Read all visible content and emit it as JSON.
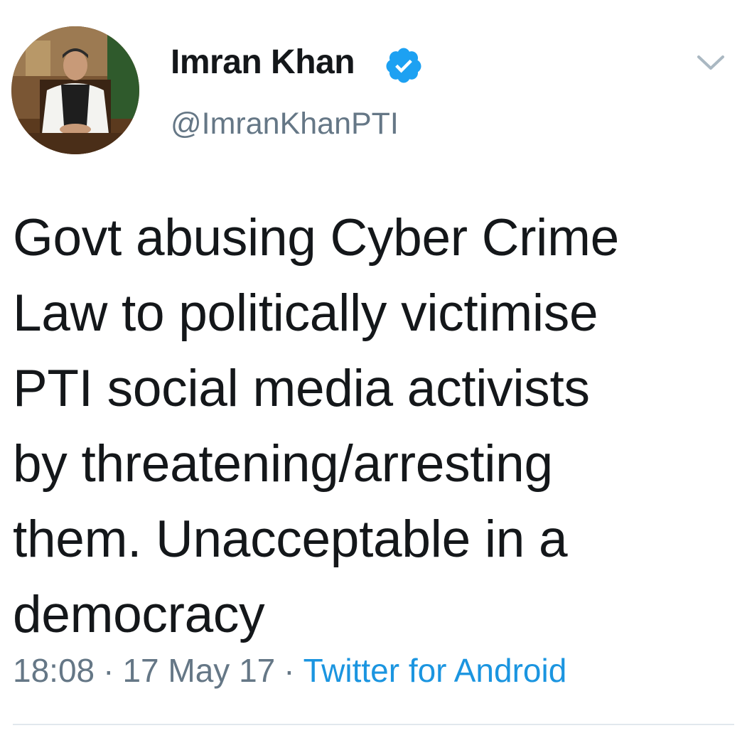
{
  "tweet": {
    "display_name": "Imran Khan",
    "verified": true,
    "handle": "@ImranKhanPTI",
    "text": "Govt abusing Cyber Crime\nLaw to politically victimise\nPTI social media activists\nby threatening/arresting\nthem. Unacceptable in a\ndemocracy",
    "time": "18:08",
    "date": "17 May 17",
    "separator": "·",
    "source": "Twitter for Android"
  },
  "icons": {
    "verified": "verified-badge-icon",
    "menu": "chevron-down-icon"
  },
  "colors": {
    "text": "#14171a",
    "secondary": "#657786",
    "link": "#1b95e0",
    "verified": "#1da1f2",
    "divider": "#e1e8ed"
  }
}
